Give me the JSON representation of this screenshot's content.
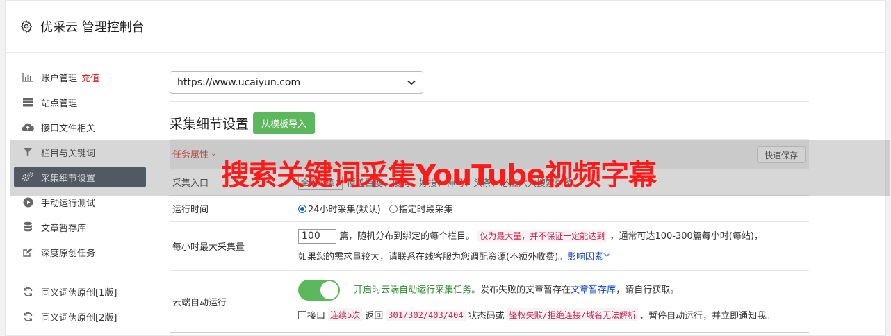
{
  "header": {
    "title": "优采云 管理控制台",
    "icon": "gear-icon"
  },
  "sidebar": {
    "items": [
      {
        "label": "账户管理",
        "badge": "充值",
        "icon": "bar-chart-icon"
      },
      {
        "label": "站点管理",
        "icon": "server-icon"
      },
      {
        "label": "接口文件相关",
        "icon": "cloud-upload-icon"
      },
      {
        "label": "栏目与关键词",
        "icon": "filter-icon"
      },
      {
        "label": "采集细节设置",
        "icon": "gears-icon",
        "active": true
      },
      {
        "label": "手动运行测试",
        "icon": "play-circle-icon"
      },
      {
        "label": "文章暂存库",
        "icon": "database-icon"
      },
      {
        "label": "深度原创任务",
        "icon": "edit-icon"
      }
    ],
    "items2": [
      {
        "label": "同义词伪原创[1版]",
        "icon": "refresh-icon"
      },
      {
        "label": "同义词伪原创[2版]",
        "icon": "refresh-icon"
      }
    ]
  },
  "main": {
    "site_select": "https://www.ucaiyun.com",
    "section_title": "采集细节设置",
    "import_button": "从模板导入",
    "task_attr": "任务属性",
    "quick_save": "快速保存",
    "entry": {
      "label": "采集入口",
      "select": "全网采集",
      "desc": "覆盖百度、搜狗、好搜、神马、头条、必应六大搜索引擎。"
    },
    "run_time": {
      "label": "运行时间",
      "opt1": "24小时采集(默认)",
      "opt2": "指定时段采集"
    },
    "max_per_hour": {
      "label": "每小时最大采集量",
      "value": "100",
      "text1": "篇，随机分布到绑定的每个栏目。",
      "code": "仅为最大量，并不保证一定能达到",
      "text2": "，通常可达100-300篇每小时(每站)，",
      "text3": "如果您的需求量较大，请联系在线客服为您调配资源(不额外收费)。",
      "link": "影响因素"
    },
    "cloud": {
      "label": "云端自动运行",
      "green": "开启时云端自动运行采集任务。",
      "text1": "发布失败的文章暂存在",
      "link": "文章暂存库",
      "text2": "，请自行获取。",
      "cb_label": "接口",
      "code1": "连续5次",
      "text3": "返回",
      "code2": "301/302/403/404",
      "text4": "状态码或",
      "code3": "鉴权失败/拒绝连接/域名无法解析",
      "text5": "，暂停自动运行，并立即通知我。"
    }
  },
  "overlay": {
    "text": "搜索关键词采集YouTube视频字幕"
  },
  "colors": {
    "accent_green": "#5cb85c",
    "active_nav": "#3a4655",
    "overlay_red": "#ff1a1a"
  }
}
